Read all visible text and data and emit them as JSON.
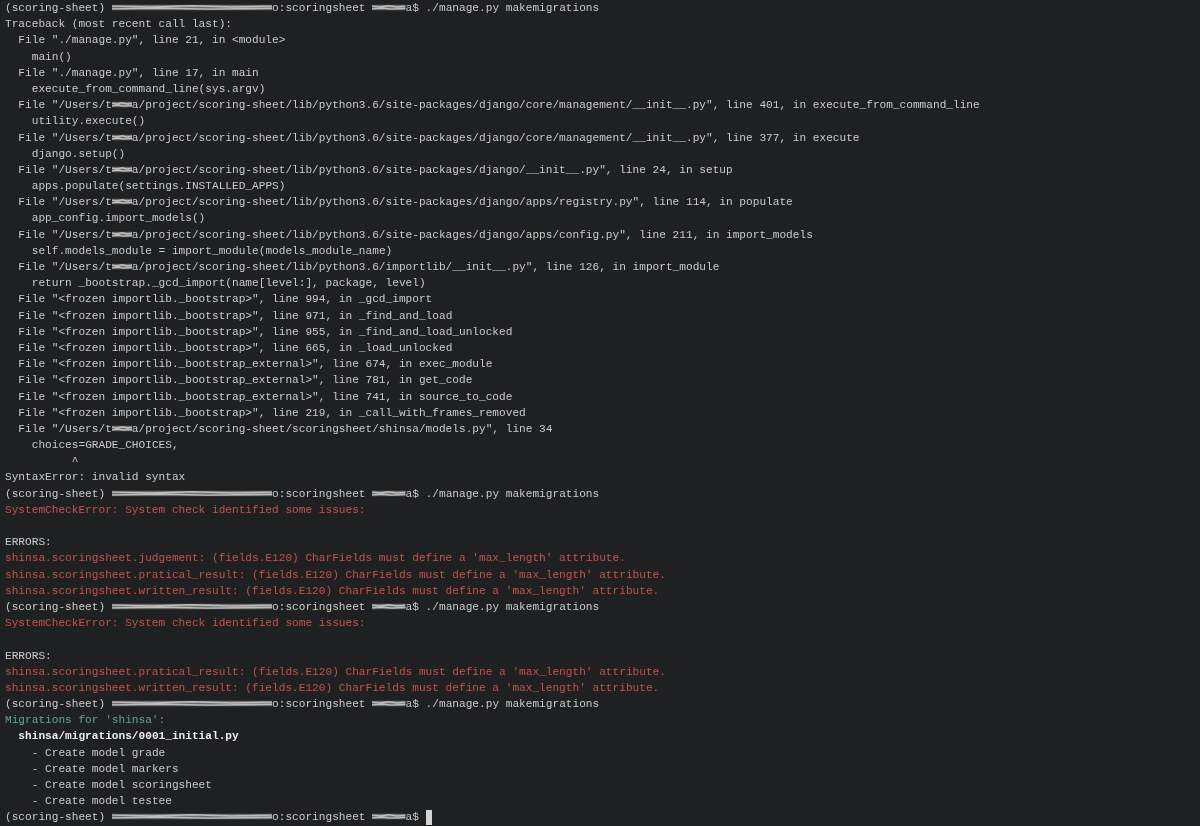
{
  "terminal": {
    "lines": [
      {
        "kind": "output",
        "parts": [
          {
            "kind": "text",
            "text": "(scoring-sheet) "
          },
          {
            "kind": "redacted-host"
          },
          {
            "kind": "text",
            "text": "o:scoringsheet "
          },
          {
            "kind": "redacted-user"
          },
          {
            "kind": "text",
            "text": "a$ ./manage.py makemigrations"
          }
        ]
      },
      {
        "kind": "output",
        "text": "Traceback (most recent call last):"
      },
      {
        "kind": "output",
        "text": "  File \"./manage.py\", line 21, in <module>"
      },
      {
        "kind": "output",
        "text": "    main()"
      },
      {
        "kind": "output",
        "text": "  File \"./manage.py\", line 17, in main"
      },
      {
        "kind": "output",
        "text": "    execute_from_command_line(sys.argv)"
      },
      {
        "kind": "output",
        "parts": [
          {
            "kind": "text",
            "text": "  File \"/Users/t"
          },
          {
            "kind": "redacted-mid"
          },
          {
            "kind": "text",
            "text": "a/project/scoring-sheet/lib/python3.6/site-packages/django/core/management/__init__.py\", line 401, in execute_from_command_line"
          }
        ]
      },
      {
        "kind": "output",
        "text": "    utility.execute()"
      },
      {
        "kind": "output",
        "parts": [
          {
            "kind": "text",
            "text": "  File \"/Users/t"
          },
          {
            "kind": "redacted-mid"
          },
          {
            "kind": "text",
            "text": "a/project/scoring-sheet/lib/python3.6/site-packages/django/core/management/__init__.py\", line 377, in execute"
          }
        ]
      },
      {
        "kind": "output",
        "text": "    django.setup()"
      },
      {
        "kind": "output",
        "parts": [
          {
            "kind": "text",
            "text": "  File \"/Users/t"
          },
          {
            "kind": "redacted-mid"
          },
          {
            "kind": "text",
            "text": "a/project/scoring-sheet/lib/python3.6/site-packages/django/__init__.py\", line 24, in setup"
          }
        ]
      },
      {
        "kind": "output",
        "text": "    apps.populate(settings.INSTALLED_APPS)"
      },
      {
        "kind": "output",
        "parts": [
          {
            "kind": "text",
            "text": "  File \"/Users/t"
          },
          {
            "kind": "redacted-mid"
          },
          {
            "kind": "text",
            "text": "a/project/scoring-sheet/lib/python3.6/site-packages/django/apps/registry.py\", line 114, in populate"
          }
        ]
      },
      {
        "kind": "output",
        "text": "    app_config.import_models()"
      },
      {
        "kind": "output",
        "parts": [
          {
            "kind": "text",
            "text": "  File \"/Users/t"
          },
          {
            "kind": "redacted-mid"
          },
          {
            "kind": "text",
            "text": "a/project/scoring-sheet/lib/python3.6/site-packages/django/apps/config.py\", line 211, in import_models"
          }
        ]
      },
      {
        "kind": "output",
        "text": "    self.models_module = import_module(models_module_name)"
      },
      {
        "kind": "output",
        "parts": [
          {
            "kind": "text",
            "text": "  File \"/Users/t"
          },
          {
            "kind": "redacted-mid"
          },
          {
            "kind": "text",
            "text": "a/project/scoring-sheet/lib/python3.6/importlib/__init__.py\", line 126, in import_module"
          }
        ]
      },
      {
        "kind": "output",
        "text": "    return _bootstrap._gcd_import(name[level:], package, level)"
      },
      {
        "kind": "output",
        "text": "  File \"<frozen importlib._bootstrap>\", line 994, in _gcd_import"
      },
      {
        "kind": "output",
        "text": "  File \"<frozen importlib._bootstrap>\", line 971, in _find_and_load"
      },
      {
        "kind": "output",
        "text": "  File \"<frozen importlib._bootstrap>\", line 955, in _find_and_load_unlocked"
      },
      {
        "kind": "output",
        "text": "  File \"<frozen importlib._bootstrap>\", line 665, in _load_unlocked"
      },
      {
        "kind": "output",
        "text": "  File \"<frozen importlib._bootstrap_external>\", line 674, in exec_module"
      },
      {
        "kind": "output",
        "text": "  File \"<frozen importlib._bootstrap_external>\", line 781, in get_code"
      },
      {
        "kind": "output",
        "text": "  File \"<frozen importlib._bootstrap_external>\", line 741, in source_to_code"
      },
      {
        "kind": "output",
        "text": "  File \"<frozen importlib._bootstrap>\", line 219, in _call_with_frames_removed"
      },
      {
        "kind": "output",
        "parts": [
          {
            "kind": "text",
            "text": "  File \"/Users/t"
          },
          {
            "kind": "redacted-mid"
          },
          {
            "kind": "text",
            "text": "a/project/scoring-sheet/scoringsheet/shinsa/models.py\", line 34"
          }
        ]
      },
      {
        "kind": "output",
        "text": "    choices=GRADE_CHOICES,"
      },
      {
        "kind": "output",
        "text": "          ^"
      },
      {
        "kind": "output",
        "text": "SyntaxError: invalid syntax"
      },
      {
        "kind": "output",
        "parts": [
          {
            "kind": "text",
            "text": "(scoring-sheet) "
          },
          {
            "kind": "redacted-host"
          },
          {
            "kind": "text",
            "text": "o:scoringsheet "
          },
          {
            "kind": "redacted-user"
          },
          {
            "kind": "text",
            "text": "a$ ./manage.py makemigrations"
          }
        ]
      },
      {
        "kind": "error",
        "text": "SystemCheckError: System check identified some issues:"
      },
      {
        "kind": "blank"
      },
      {
        "kind": "output",
        "text": "ERRORS:"
      },
      {
        "kind": "error",
        "text": "shinsa.scoringsheet.judgement: (fields.E120) CharFields must define a 'max_length' attribute."
      },
      {
        "kind": "error",
        "text": "shinsa.scoringsheet.pratical_result: (fields.E120) CharFields must define a 'max_length' attribute."
      },
      {
        "kind": "error",
        "text": "shinsa.scoringsheet.written_result: (fields.E120) CharFields must define a 'max_length' attribute."
      },
      {
        "kind": "output",
        "parts": [
          {
            "kind": "text",
            "text": "(scoring-sheet) "
          },
          {
            "kind": "redacted-host"
          },
          {
            "kind": "text",
            "text": "o:scoringsheet "
          },
          {
            "kind": "redacted-user"
          },
          {
            "kind": "text",
            "text": "a$ ./manage.py makemigrations"
          }
        ]
      },
      {
        "kind": "error",
        "text": "SystemCheckError: System check identified some issues:"
      },
      {
        "kind": "blank"
      },
      {
        "kind": "output",
        "text": "ERRORS:"
      },
      {
        "kind": "error",
        "text": "shinsa.scoringsheet.pratical_result: (fields.E120) CharFields must define a 'max_length' attribute."
      },
      {
        "kind": "error",
        "text": "shinsa.scoringsheet.written_result: (fields.E120) CharFields must define a 'max_length' attribute."
      },
      {
        "kind": "output",
        "parts": [
          {
            "kind": "text",
            "text": "(scoring-sheet) "
          },
          {
            "kind": "redacted-host"
          },
          {
            "kind": "text",
            "text": "o:scoringsheet "
          },
          {
            "kind": "redacted-user"
          },
          {
            "kind": "text",
            "text": "a$ ./manage.py makemigrations"
          }
        ]
      },
      {
        "kind": "notice",
        "text": "Migrations for 'shinsa':"
      },
      {
        "kind": "strong",
        "text": "  shinsa/migrations/0001_initial.py"
      },
      {
        "kind": "output",
        "text": "    - Create model grade"
      },
      {
        "kind": "output",
        "text": "    - Create model markers"
      },
      {
        "kind": "output",
        "text": "    - Create model scoringsheet"
      },
      {
        "kind": "output",
        "text": "    - Create model testee"
      },
      {
        "kind": "output",
        "parts": [
          {
            "kind": "text",
            "text": "(scoring-sheet) "
          },
          {
            "kind": "redacted-host"
          },
          {
            "kind": "text",
            "text": "o:scoringsheet "
          },
          {
            "kind": "redacted-user"
          },
          {
            "kind": "text",
            "text": "a$ "
          },
          {
            "kind": "cursor"
          }
        ]
      }
    ]
  }
}
